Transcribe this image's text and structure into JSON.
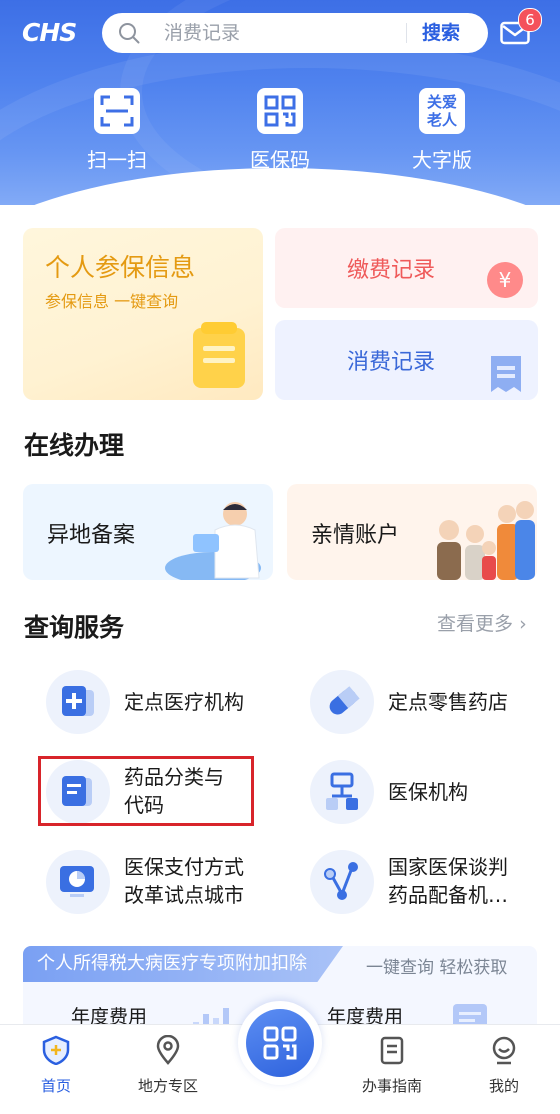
{
  "header": {
    "logo_text": "CHS",
    "search_placeholder": "消费记录",
    "search_button": "搜索",
    "mail_badge": "6"
  },
  "quick_actions": [
    {
      "label": "扫一扫",
      "icon": "scan-icon"
    },
    {
      "label": "医保码",
      "icon": "qrcode-icon"
    },
    {
      "label": "大字版",
      "icon": "elder-care-icon",
      "icon_text": "关爱\n老人"
    }
  ],
  "cards": {
    "info_title": "个人参保信息",
    "info_sub": "参保信息 一键查询",
    "pay_title": "缴费记录",
    "spend_title": "消费记录"
  },
  "online": {
    "section_title": "在线办理",
    "remote_filing": "异地备案",
    "family_account": "亲情账户"
  },
  "query": {
    "section_title": "查询服务",
    "more": "查看更多",
    "items": [
      {
        "label": "定点医疗机构",
        "icon": "hospital-icon"
      },
      {
        "label": "定点零售药店",
        "icon": "pill-icon"
      },
      {
        "label": "药品分类与\n代码",
        "icon": "drug-code-icon"
      },
      {
        "label": "医保机构",
        "icon": "org-tree-icon"
      },
      {
        "label": "医保支付方式\n改革试点城市",
        "icon": "monitor-chart-icon"
      },
      {
        "label": "国家医保谈判\n药品配备机…",
        "icon": "network-icon"
      }
    ]
  },
  "promo": {
    "tag": "个人所得税大病医疗专项附加扣除",
    "sub": "一键查询 轻松获取",
    "year1": "年度费用",
    "year2": "年度费用"
  },
  "tabbar": [
    {
      "label": "首页",
      "icon": "home-shield-icon",
      "active": true
    },
    {
      "label": "地方专区",
      "icon": "location-pin-icon",
      "active": false
    },
    {
      "label": "",
      "icon": "center-qr-icon",
      "active": false
    },
    {
      "label": "办事指南",
      "icon": "guide-doc-icon",
      "active": false
    },
    {
      "label": "我的",
      "icon": "profile-icon",
      "active": false
    }
  ],
  "colors": {
    "accent": "#2a5fe0",
    "highlight_border": "#d8242a"
  }
}
